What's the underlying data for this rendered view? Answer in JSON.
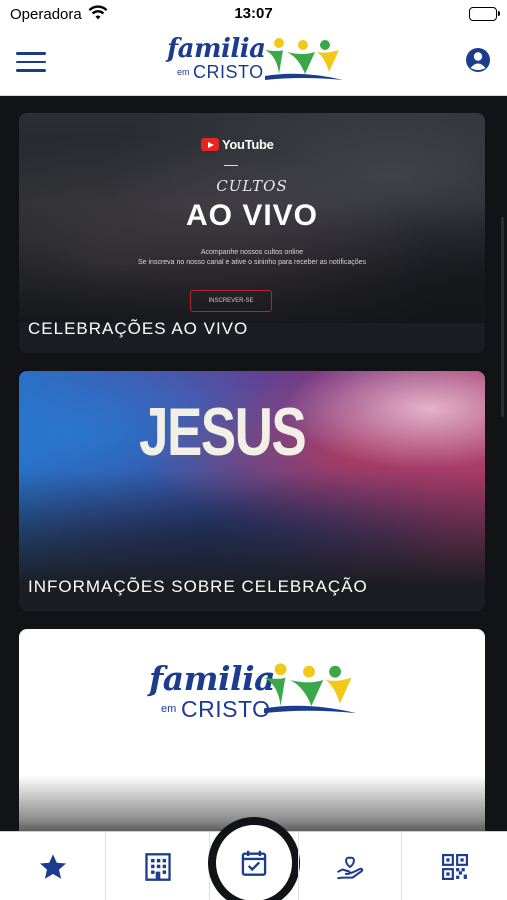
{
  "status_bar": {
    "carrier": "Operadora",
    "time": "13:07"
  },
  "header": {
    "logo": {
      "familia": "familia",
      "em": "em",
      "cristo": "CRISTO"
    }
  },
  "cards": [
    {
      "banner": {
        "youtube": "YouTube",
        "cultos": "CULTOS",
        "ao_vivo": "AO VIVO",
        "line1": "Acompanhe nossos cultos online",
        "line2": "Se inscreva no nosso canal e ative o sininho para receber as notificações",
        "button": "INSCREVER-SE"
      },
      "title": "CELEBRAÇÕES AO VIVO"
    },
    {
      "banner": {
        "word": "JESUS"
      },
      "title": "INFORMAÇÕES SOBRE CELEBRAÇÃO"
    },
    {
      "logo": {
        "familia": "familia",
        "em": "em",
        "cristo": "CRISTO"
      }
    }
  ],
  "tabbar": {
    "items": [
      "star-icon",
      "building-icon",
      "calendar-check-icon",
      "heart-hand-icon",
      "qr-code-icon"
    ]
  },
  "colors": {
    "brand_blue": "#1c3c8e",
    "brand_green": "#3aa848",
    "brand_yellow": "#f2c81a",
    "background": "#111316"
  }
}
